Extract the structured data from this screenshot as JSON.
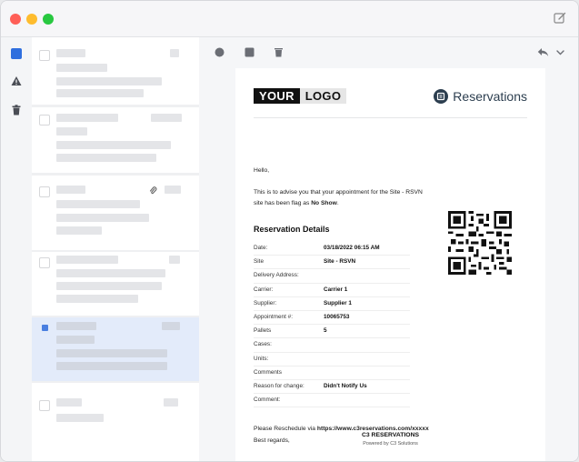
{
  "email": {
    "logo_part1": "YOUR",
    "logo_part2": "LOGO",
    "brand_name": "Reservations",
    "greeting": "Hello,",
    "intro_line1": "This is to advise you that your appointment for the Site - RSVN",
    "intro_line2_prefix": "site has been flag as ",
    "intro_status": "No Show",
    "intro_suffix": ".",
    "section_title": "Reservation Details",
    "details": [
      {
        "label": "Date:",
        "value": "03/18/2022 06:15 AM"
      },
      {
        "label": "Site",
        "value": "Site - RSVN"
      },
      {
        "label": "Delivery Address:",
        "value": ""
      },
      {
        "label": "Carrier:",
        "value": "Carrier 1"
      },
      {
        "label": "Supplier:",
        "value": "Supplier 1"
      },
      {
        "label": "Appointment #:",
        "value": "10065753"
      },
      {
        "label": "Pallets",
        "value": "5"
      },
      {
        "label": "Cases:",
        "value": ""
      },
      {
        "label": "Units:",
        "value": ""
      },
      {
        "label": "Comments",
        "value": ""
      },
      {
        "label": "Reason for change:",
        "value": "Didn't Notify Us"
      },
      {
        "label": "Comment:",
        "value": ""
      }
    ],
    "reschedule_prefix": "Please Reschedule via ",
    "reschedule_link": "https://www.c3reservations.com/xxxxx",
    "regards": "Best regards,",
    "footer_title": "C3 RESERVATIONS",
    "footer_sub": "Powered by C3 Solutions"
  },
  "colors": {
    "accent": "#2f6fde",
    "selected_row": "#e3ebfa",
    "brand": "#2c3e4f"
  },
  "icons": {
    "compose": "compose-icon",
    "inbox": "inbox-icon",
    "spam": "warning-icon",
    "trash": "trash-icon",
    "reply": "reply-icon",
    "more": "chevron-down-icon"
  }
}
